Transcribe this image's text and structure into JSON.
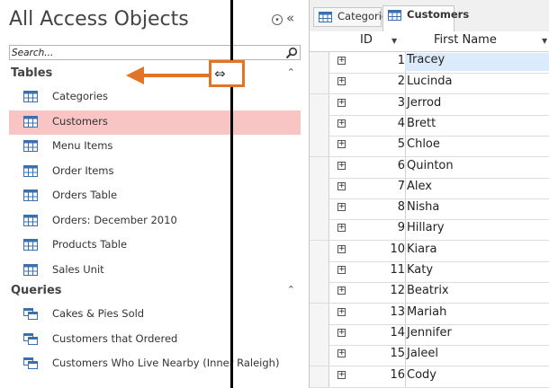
{
  "nav": {
    "title": "All Access Objects",
    "menu_icon": "dropdown-circle-icon",
    "shutter_glyph": "«",
    "search_placeholder": "Search...",
    "groups": [
      {
        "label": "Tables",
        "collapse_glyph": "⌃",
        "items": [
          {
            "label": "Categories",
            "icon": "table-icon",
            "selected": false
          },
          {
            "label": "Customers",
            "icon": "table-icon",
            "selected": true
          },
          {
            "label": "Menu Items",
            "icon": "table-icon",
            "selected": false
          },
          {
            "label": "Order Items",
            "icon": "table-icon",
            "selected": false
          },
          {
            "label": "Orders Table",
            "icon": "table-icon",
            "selected": false
          },
          {
            "label": "Orders: December 2010",
            "icon": "table-icon",
            "selected": false
          },
          {
            "label": "Products Table",
            "icon": "table-icon",
            "selected": false
          },
          {
            "label": "Sales Unit",
            "icon": "table-icon",
            "selected": false
          }
        ]
      },
      {
        "label": "Queries",
        "collapse_glyph": "⌃",
        "items": [
          {
            "label": "Cakes & Pies Sold",
            "icon": "query-icon",
            "selected": false
          },
          {
            "label": "Customers that Ordered",
            "icon": "query-icon",
            "selected": false
          },
          {
            "label": "Customers Who Live Nearby (Inner Raleigh)",
            "icon": "query-icon",
            "selected": false
          }
        ]
      }
    ],
    "resize_glyph": "⇔",
    "highlight_color": "#e07528",
    "selected_color": "#f8c4c4"
  },
  "tabs": [
    {
      "label": "Categories",
      "active": false
    },
    {
      "label": "Customers",
      "active": true
    }
  ],
  "sheet": {
    "columns": [
      "ID",
      "First Name"
    ],
    "rows": [
      {
        "id": "1",
        "first_name": "Tracey"
      },
      {
        "id": "2",
        "first_name": "Lucinda"
      },
      {
        "id": "3",
        "first_name": "Jerrod"
      },
      {
        "id": "4",
        "first_name": "Brett"
      },
      {
        "id": "5",
        "first_name": "Chloe"
      },
      {
        "id": "6",
        "first_name": "Quinton"
      },
      {
        "id": "7",
        "first_name": "Alex"
      },
      {
        "id": "8",
        "first_name": "Nisha"
      },
      {
        "id": "9",
        "first_name": "Hillary"
      },
      {
        "id": "10",
        "first_name": "Kiara"
      },
      {
        "id": "11",
        "first_name": "Katy"
      },
      {
        "id": "12",
        "first_name": "Beatrix"
      },
      {
        "id": "13",
        "first_name": "Mariah"
      },
      {
        "id": "14",
        "first_name": "Jennifer"
      },
      {
        "id": "15",
        "first_name": "Jaleel"
      },
      {
        "id": "16",
        "first_name": "Cody"
      }
    ]
  }
}
